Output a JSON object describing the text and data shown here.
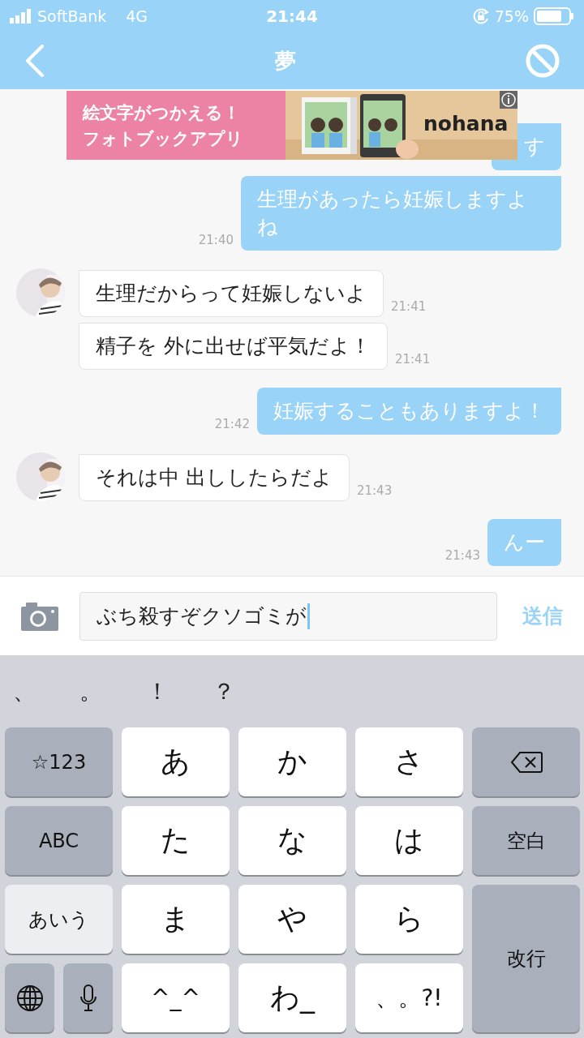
{
  "status_bar": {
    "carrier": "SoftBank",
    "network": "4G",
    "time": "21:44",
    "battery": "75%"
  },
  "header": {
    "title": "夢"
  },
  "ad": {
    "headline": "絵文字がつかえる！",
    "subline": "フォトブックアプリ",
    "brand": "nohana"
  },
  "messages": [
    {
      "kind": "sent",
      "text": "す"
    },
    {
      "kind": "sent",
      "text": "生理があったら妊娠しますよね",
      "time": "21:40"
    },
    {
      "kind": "received",
      "avatar": true,
      "text": "生理だからって妊娠しないよ",
      "time": "21:41"
    },
    {
      "kind": "received",
      "avatar": false,
      "text": "精子を 外に出せば平気だよ！",
      "time": "21:41"
    },
    {
      "kind": "sent",
      "text": "妊娠することもありますよ！",
      "time": "21:42"
    },
    {
      "kind": "received",
      "avatar": true,
      "text": "それは中 出ししたらだよ",
      "time": "21:43"
    },
    {
      "kind": "sent",
      "text": "んー",
      "time": "21:43"
    }
  ],
  "composer": {
    "value": "ぶち殺すぞクソゴミが",
    "send": "送信"
  },
  "keyboard": {
    "suggestions": [
      "、",
      "。",
      "！",
      "？"
    ],
    "keys": [
      {
        "kind": "function",
        "label": "☆123"
      },
      {
        "kind": "char",
        "label": "あ"
      },
      {
        "kind": "char",
        "label": "か"
      },
      {
        "kind": "char",
        "label": "さ"
      },
      {
        "kind": "backspace"
      },
      {
        "kind": "function",
        "label": "ABC"
      },
      {
        "kind": "char",
        "label": "た"
      },
      {
        "kind": "char",
        "label": "な"
      },
      {
        "kind": "char",
        "label": "は"
      },
      {
        "kind": "function",
        "label": "空白"
      },
      {
        "kind": "mode",
        "label": "あいう"
      },
      {
        "kind": "char",
        "label": "ま"
      },
      {
        "kind": "char",
        "label": "や"
      },
      {
        "kind": "char",
        "label": "ら"
      },
      {
        "kind": "return",
        "label": "改行"
      },
      {
        "kind": "globe"
      },
      {
        "kind": "mic"
      },
      {
        "kind": "char",
        "label": "^_^"
      },
      {
        "kind": "char",
        "label": "わ_"
      },
      {
        "kind": "char",
        "label": "、。?!"
      }
    ]
  }
}
